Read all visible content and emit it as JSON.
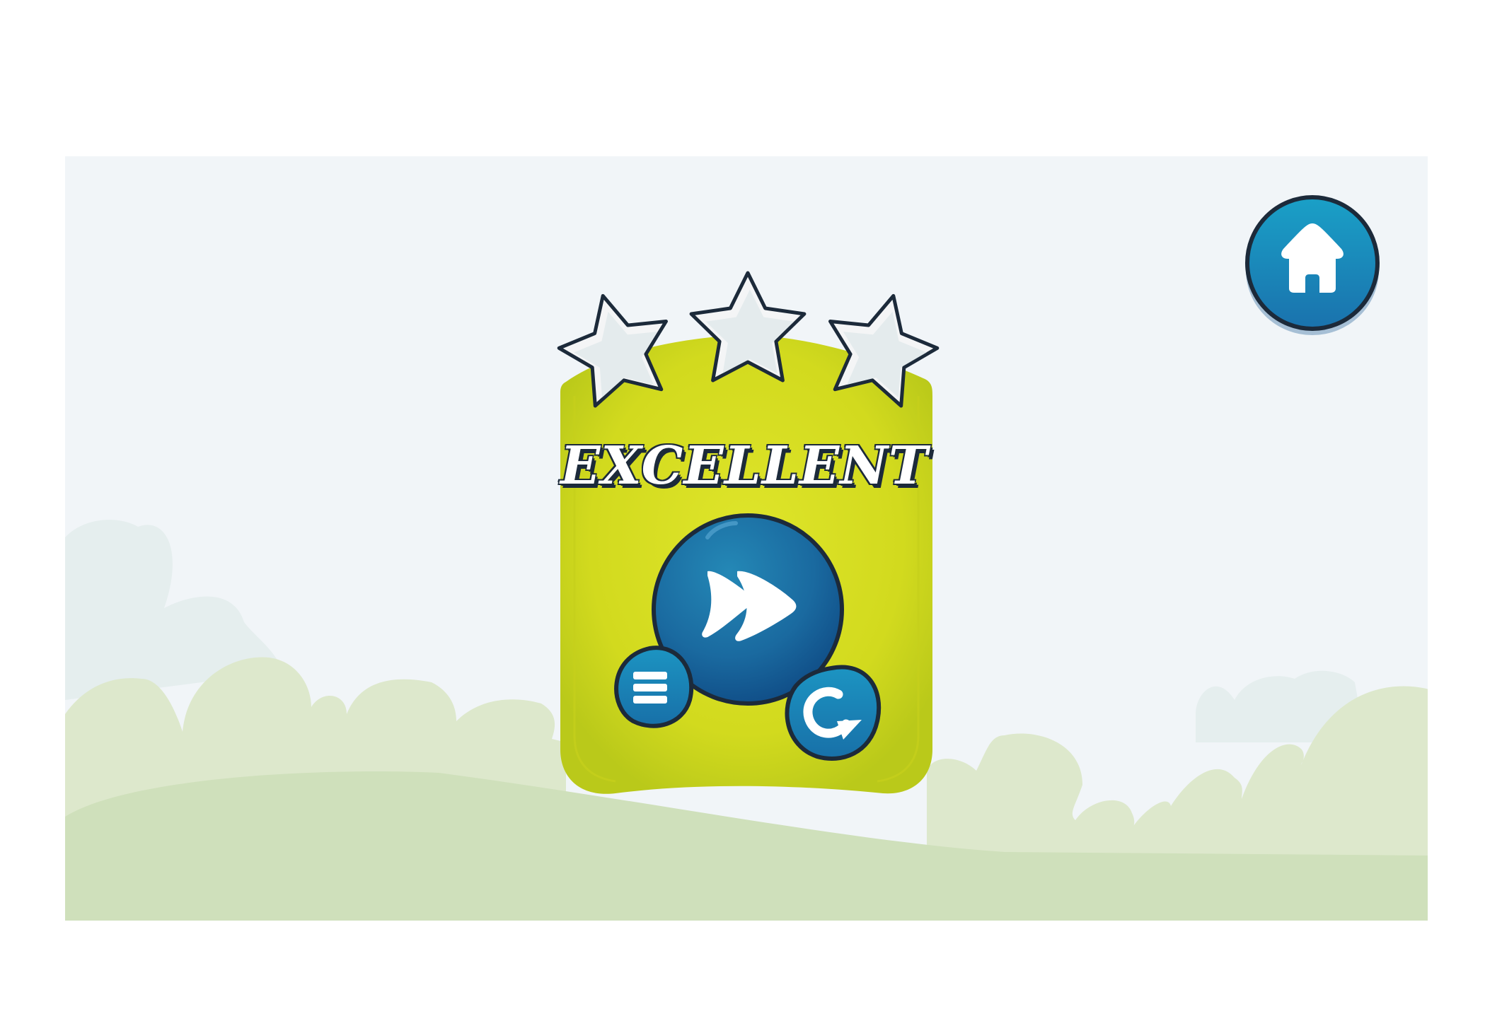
{
  "level_complete": {
    "title": "EXCELLENT",
    "stars_earned": 3,
    "stars_total": 3
  },
  "buttons": {
    "home": {
      "icon": "home-icon"
    },
    "next_level": {
      "icon": "fast-forward-icon"
    },
    "menu": {
      "icon": "menu-icon"
    },
    "replay": {
      "icon": "replay-icon"
    }
  },
  "colors": {
    "background": "#f1f5f8",
    "card": "#d3dc22",
    "button_blue": "#1a7fb0",
    "star_fill": "#f4f5f6",
    "outline": "#1c2a3a",
    "hill_light": "#dde8cc",
    "hill_dark": "#cfe0bb"
  }
}
